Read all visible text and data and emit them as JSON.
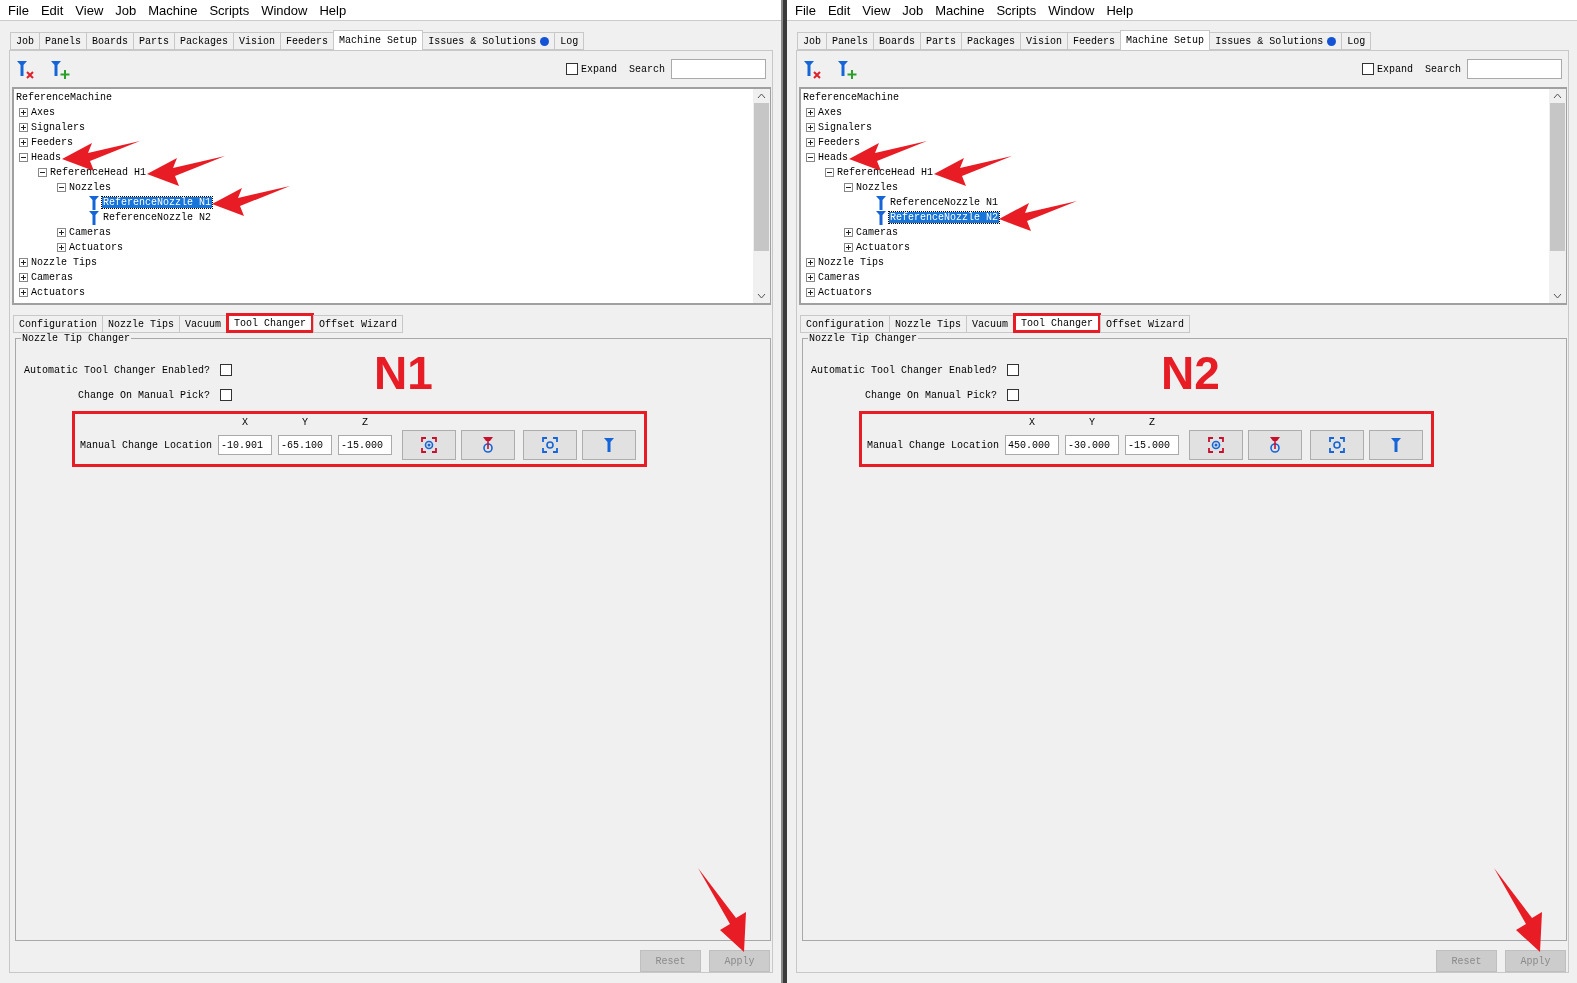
{
  "panes": [
    {
      "menu": [
        "File",
        "Edit",
        "View",
        "Job",
        "Machine",
        "Scripts",
        "Window",
        "Help"
      ],
      "tabs": [
        {
          "label": "Job",
          "selected": false,
          "dot": false
        },
        {
          "label": "Panels",
          "selected": false,
          "dot": false
        },
        {
          "label": "Boards",
          "selected": false,
          "dot": false
        },
        {
          "label": "Parts",
          "selected": false,
          "dot": false
        },
        {
          "label": "Packages",
          "selected": false,
          "dot": false
        },
        {
          "label": "Vision",
          "selected": false,
          "dot": false
        },
        {
          "label": "Feeders",
          "selected": false,
          "dot": false
        },
        {
          "label": "Machine Setup",
          "selected": true,
          "dot": false
        },
        {
          "label": "Issues & Solutions",
          "selected": false,
          "dot": true
        },
        {
          "label": "Log",
          "selected": false,
          "dot": false
        }
      ],
      "toolbar": {
        "expand_label": "Expand",
        "expand_checked": false,
        "search_label": "Search"
      },
      "tree": [
        {
          "label": "ReferenceMachine",
          "kind": "root",
          "selected": false,
          "arrow": false,
          "children": [
            {
              "label": "Axes",
              "kind": "group",
              "expanded": false,
              "selected": false,
              "arrow": false
            },
            {
              "label": "Signalers",
              "kind": "group",
              "expanded": false,
              "selected": false,
              "arrow": false
            },
            {
              "label": "Feeders",
              "kind": "group",
              "expanded": false,
              "selected": false,
              "arrow": false
            },
            {
              "label": "Heads",
              "kind": "group",
              "expanded": true,
              "selected": false,
              "arrow": true,
              "children": [
                {
                  "label": "ReferenceHead H1",
                  "kind": "group",
                  "expanded": true,
                  "selected": false,
                  "arrow": true,
                  "children": [
                    {
                      "label": "Nozzles",
                      "kind": "group",
                      "expanded": true,
                      "selected": false,
                      "arrow": false,
                      "children": [
                        {
                          "label": "ReferenceNozzle N1",
                          "kind": "nozzle",
                          "expanded": false,
                          "selected": true,
                          "arrow": true
                        },
                        {
                          "label": "ReferenceNozzle N2",
                          "kind": "nozzle",
                          "expanded": false,
                          "selected": false,
                          "arrow": false
                        }
                      ]
                    },
                    {
                      "label": "Cameras",
                      "kind": "group",
                      "expanded": false,
                      "selected": false,
                      "arrow": false
                    },
                    {
                      "label": "Actuators",
                      "kind": "group",
                      "expanded": false,
                      "selected": false,
                      "arrow": false
                    }
                  ]
                }
              ]
            },
            {
              "label": "Nozzle Tips",
              "kind": "group",
              "expanded": false,
              "selected": false,
              "arrow": false
            },
            {
              "label": "Cameras",
              "kind": "group",
              "expanded": false,
              "selected": false,
              "arrow": false
            },
            {
              "label": "Actuators",
              "kind": "group",
              "expanded": false,
              "selected": false,
              "arrow": false
            }
          ]
        }
      ],
      "detail_tabs": [
        {
          "label": "Configuration",
          "selected": false,
          "highlighted": false
        },
        {
          "label": "Nozzle Tips",
          "selected": false,
          "highlighted": false
        },
        {
          "label": "Vacuum",
          "selected": false,
          "highlighted": false
        },
        {
          "label": "Tool Changer",
          "selected": true,
          "highlighted": true
        },
        {
          "label": "Offset Wizard",
          "selected": false,
          "highlighted": false
        }
      ],
      "group": {
        "title": "Nozzle Tip Changer",
        "annotation": "N1",
        "checks": [
          {
            "label": "Automatic Tool Changer Enabled?",
            "checked": false
          },
          {
            "label": "Change On Manual Pick?",
            "checked": false
          }
        ],
        "location": {
          "label": "Manual Change Location",
          "highlighted": true,
          "headers": [
            "X",
            "Y",
            "Z"
          ],
          "values": [
            "-10.901",
            "-65.100",
            "-15.000"
          ]
        }
      },
      "buttons": [
        {
          "label": "Reset",
          "disabled": true,
          "arrow": false
        },
        {
          "label": "Apply",
          "disabled": true,
          "arrow": true
        }
      ]
    },
    {
      "menu": [
        "File",
        "Edit",
        "View",
        "Job",
        "Machine",
        "Scripts",
        "Window",
        "Help"
      ],
      "tabs": [
        {
          "label": "Job",
          "selected": false,
          "dot": false
        },
        {
          "label": "Panels",
          "selected": false,
          "dot": false
        },
        {
          "label": "Boards",
          "selected": false,
          "dot": false
        },
        {
          "label": "Parts",
          "selected": false,
          "dot": false
        },
        {
          "label": "Packages",
          "selected": false,
          "dot": false
        },
        {
          "label": "Vision",
          "selected": false,
          "dot": false
        },
        {
          "label": "Feeders",
          "selected": false,
          "dot": false
        },
        {
          "label": "Machine Setup",
          "selected": true,
          "dot": false
        },
        {
          "label": "Issues & Solutions",
          "selected": false,
          "dot": true
        },
        {
          "label": "Log",
          "selected": false,
          "dot": false
        }
      ],
      "toolbar": {
        "expand_label": "Expand",
        "expand_checked": false,
        "search_label": "Search"
      },
      "tree": [
        {
          "label": "ReferenceMachine",
          "kind": "root",
          "selected": false,
          "arrow": false,
          "children": [
            {
              "label": "Axes",
              "kind": "group",
              "expanded": false,
              "selected": false,
              "arrow": false
            },
            {
              "label": "Signalers",
              "kind": "group",
              "expanded": false,
              "selected": false,
              "arrow": false
            },
            {
              "label": "Feeders",
              "kind": "group",
              "expanded": false,
              "selected": false,
              "arrow": false
            },
            {
              "label": "Heads",
              "kind": "group",
              "expanded": true,
              "selected": false,
              "arrow": true,
              "children": [
                {
                  "label": "ReferenceHead H1",
                  "kind": "group",
                  "expanded": true,
                  "selected": false,
                  "arrow": true,
                  "children": [
                    {
                      "label": "Nozzles",
                      "kind": "group",
                      "expanded": true,
                      "selected": false,
                      "arrow": false,
                      "children": [
                        {
                          "label": "ReferenceNozzle N1",
                          "kind": "nozzle",
                          "expanded": false,
                          "selected": false,
                          "arrow": false
                        },
                        {
                          "label": "ReferenceNozzle N2",
                          "kind": "nozzle",
                          "expanded": false,
                          "selected": true,
                          "arrow": true
                        }
                      ]
                    },
                    {
                      "label": "Cameras",
                      "kind": "group",
                      "expanded": false,
                      "selected": false,
                      "arrow": false
                    },
                    {
                      "label": "Actuators",
                      "kind": "group",
                      "expanded": false,
                      "selected": false,
                      "arrow": false
                    }
                  ]
                }
              ]
            },
            {
              "label": "Nozzle Tips",
              "kind": "group",
              "expanded": false,
              "selected": false,
              "arrow": false
            },
            {
              "label": "Cameras",
              "kind": "group",
              "expanded": false,
              "selected": false,
              "arrow": false
            },
            {
              "label": "Actuators",
              "kind": "group",
              "expanded": false,
              "selected": false,
              "arrow": false
            }
          ]
        }
      ],
      "detail_tabs": [
        {
          "label": "Configuration",
          "selected": false,
          "highlighted": false
        },
        {
          "label": "Nozzle Tips",
          "selected": false,
          "highlighted": false
        },
        {
          "label": "Vacuum",
          "selected": false,
          "highlighted": false
        },
        {
          "label": "Tool Changer",
          "selected": true,
          "highlighted": true
        },
        {
          "label": "Offset Wizard",
          "selected": false,
          "highlighted": false
        }
      ],
      "group": {
        "title": "Nozzle Tip Changer",
        "annotation": "N2",
        "checks": [
          {
            "label": "Automatic Tool Changer Enabled?",
            "checked": false
          },
          {
            "label": "Change On Manual Pick?",
            "checked": false
          }
        ],
        "location": {
          "label": "Manual Change Location",
          "highlighted": true,
          "headers": [
            "X",
            "Y",
            "Z"
          ],
          "values": [
            "450.000",
            "-30.000",
            "-15.000"
          ]
        }
      },
      "buttons": [
        {
          "label": "Reset",
          "disabled": true,
          "arrow": false
        },
        {
          "label": "Apply",
          "disabled": true,
          "arrow": true
        }
      ]
    }
  ]
}
